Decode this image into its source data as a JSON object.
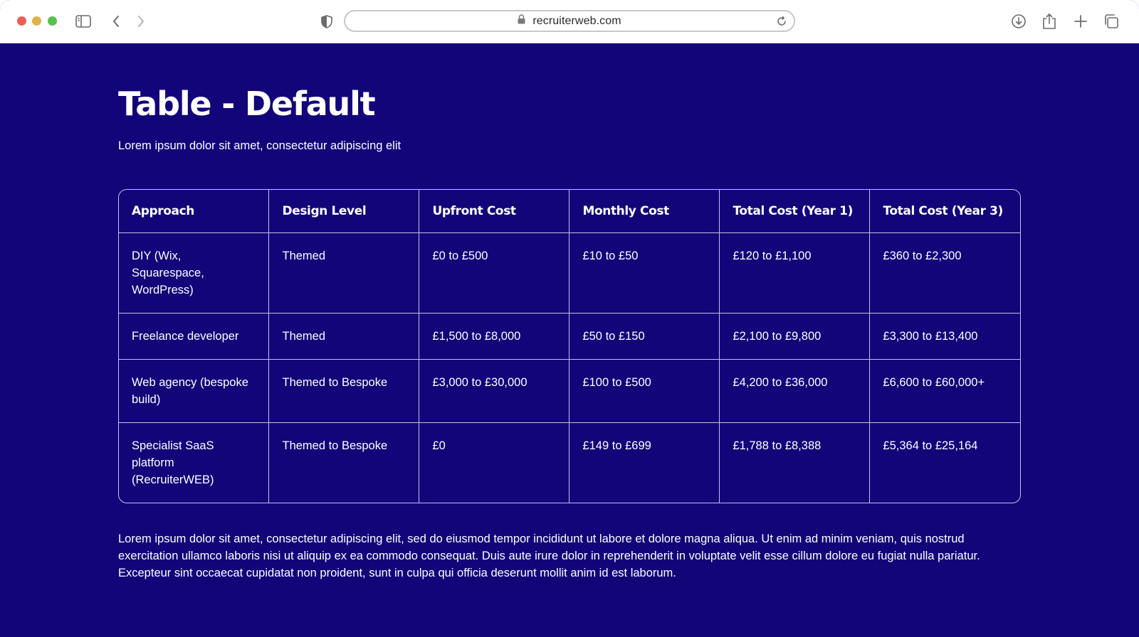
{
  "browser": {
    "url": "recruiterweb.com",
    "colors": {
      "close": "#ec5f57",
      "minimize": "#e0b24b",
      "zoom": "#58c14d"
    },
    "icons": [
      "sidebar-icon",
      "back-icon",
      "forward-icon",
      "shield-icon",
      "lock-icon",
      "reload-icon",
      "download-icon",
      "share-icon",
      "new-tab-icon",
      "tabs-overview-icon"
    ]
  },
  "page": {
    "background": "#12057a",
    "title": "Table - Default",
    "subtitle": "Lorem ipsum dolor sit amet, consectetur adipiscing elit",
    "table": {
      "headers": [
        "Approach",
        "Design Level",
        "Upfront Cost",
        "Monthly Cost",
        "Total Cost (Year 1)",
        "Total Cost (Year 3)"
      ],
      "rows": [
        [
          "DIY (Wix, Squarespace, WordPress)",
          "Themed",
          "£0 to £500",
          "£10 to £50",
          "£120 to £1,100",
          "£360 to £2,300"
        ],
        [
          "Freelance developer",
          "Themed",
          "£1,500 to £8,000",
          "£50 to £150",
          "£2,100 to £9,800",
          "£3,300 to £13,400"
        ],
        [
          "Web agency (bespoke build)",
          "Themed to Bespoke",
          "£3,000 to £30,000",
          "£100 to £500",
          "£4,200 to £36,000",
          "£6,600 to £60,000+"
        ],
        [
          "Specialist SaaS platform (RecruiterWEB)",
          "Themed to Bespoke",
          "£0",
          "£149 to £699",
          "£1,788 to £8,388",
          "£5,364 to £25,164"
        ]
      ]
    },
    "body_text": "Lorem ipsum dolor sit amet, consectetur adipiscing elit, sed do eiusmod tempor incididunt ut labore et dolore magna aliqua. Ut enim ad minim veniam, quis nostrud exercitation ullamco laboris nisi ut aliquip ex ea commodo consequat. Duis aute irure dolor in reprehenderit in voluptate velit esse cillum dolore eu fugiat nulla pariatur. Excepteur sint occaecat cupidatat non proident, sunt in culpa qui officia deserunt mollit anim id est laborum."
  }
}
